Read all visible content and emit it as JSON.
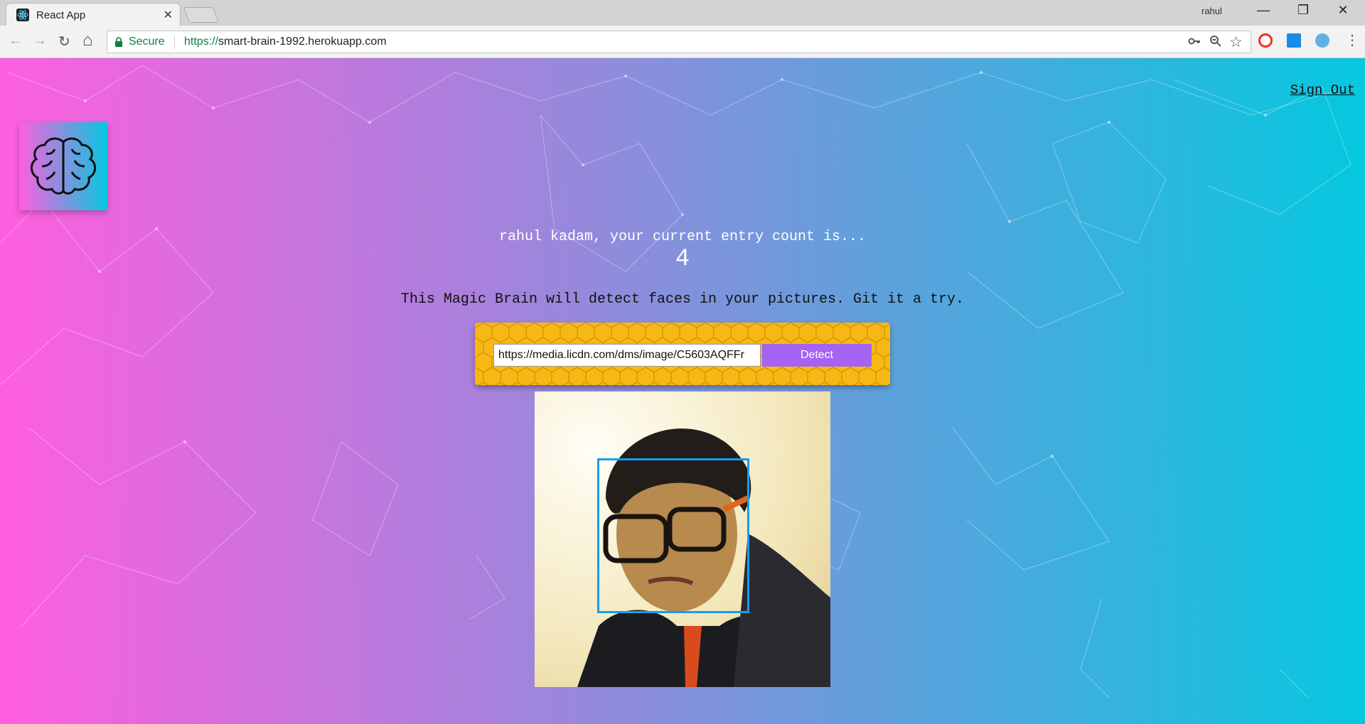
{
  "browser": {
    "tab_title": "React App",
    "tab_close": "✕",
    "profile_name": "rahul",
    "minimize": "—",
    "restore": "❐",
    "close": "✕",
    "back": "←",
    "forward": "→",
    "reload": "↻",
    "home": "⌂",
    "secure_label": "Secure",
    "url_scheme": "https://",
    "url_host": "smart-brain-1992.herokuapp.com",
    "star": "☆"
  },
  "nav": {
    "sign_out": "Sign Out"
  },
  "rank": {
    "message": "rahul kadam, your current entry count is...",
    "count": "4"
  },
  "image_link_form": {
    "description": "This Magic Brain will detect faces in your pictures. Git it a try.",
    "input_value": "https://media.licdn.com/dms/image/C5603AQFFr",
    "button_label": "Detect"
  },
  "colors": {
    "gradient_start": "#ff5edf",
    "gradient_end": "#04c8de",
    "detect_button": "#a463f2",
    "form_background": "#f8b813",
    "face_box": "#149df2"
  }
}
